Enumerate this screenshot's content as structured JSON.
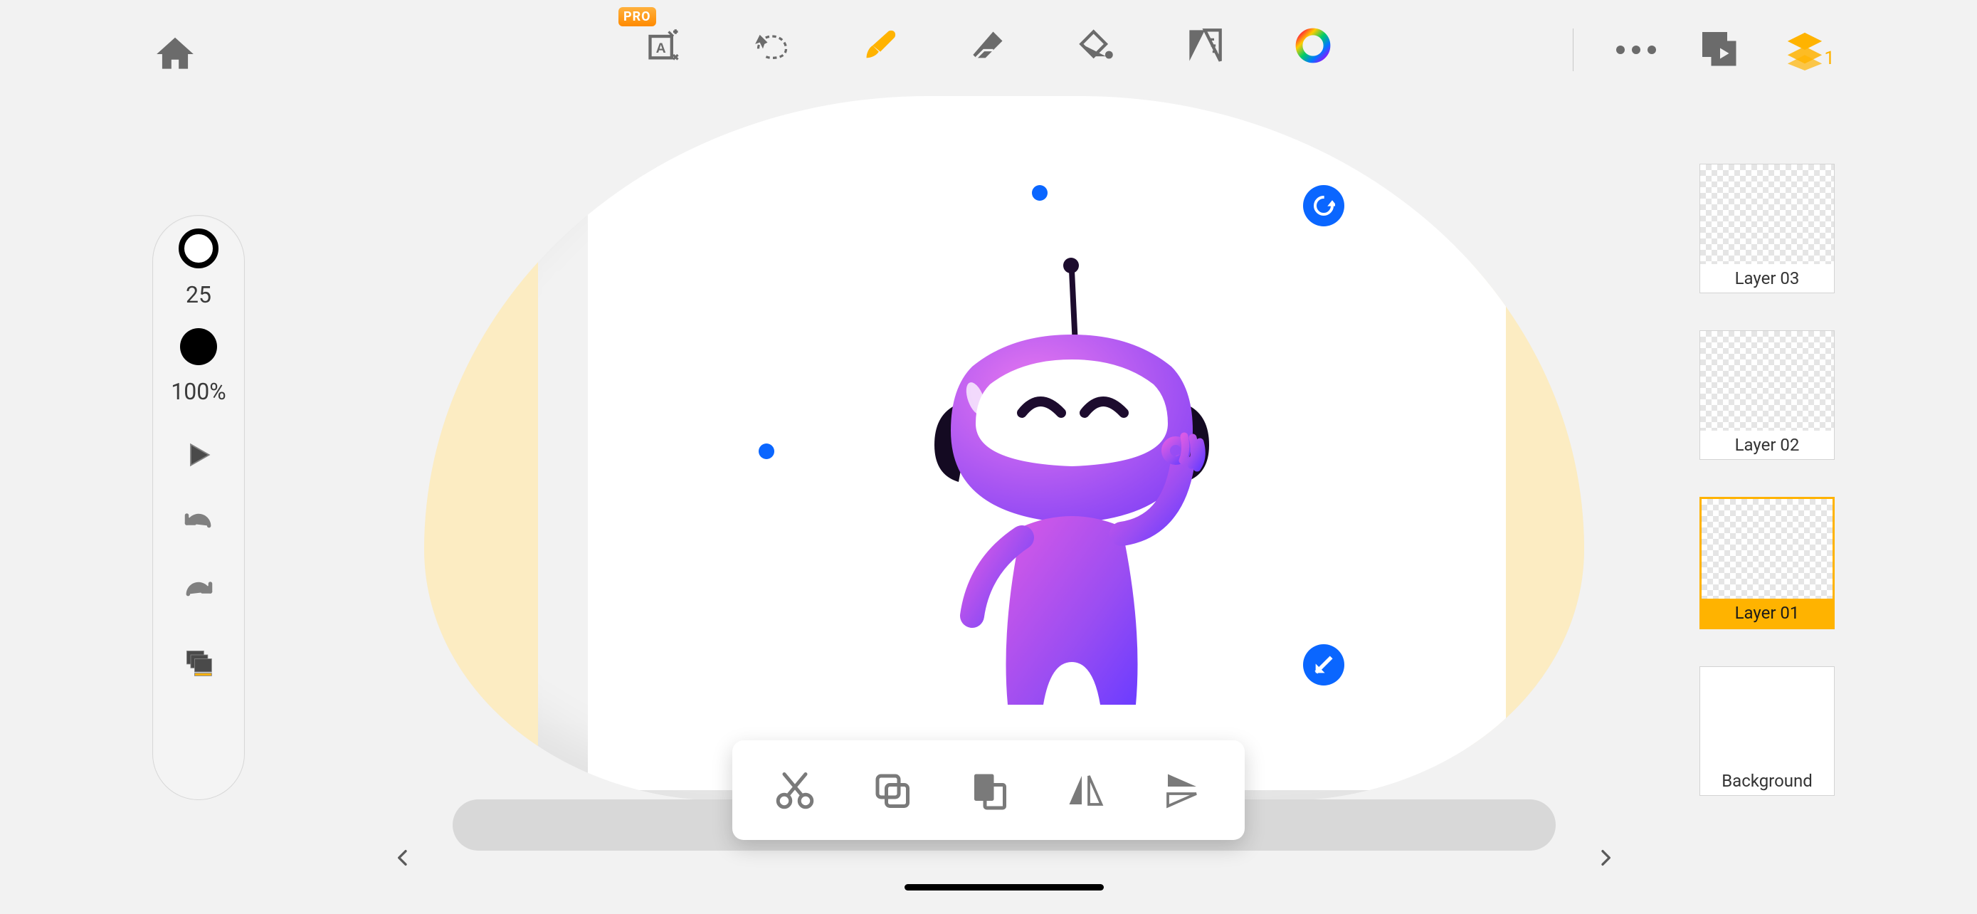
{
  "colors": {
    "accent_orange": "#ffb300",
    "selection_blue": "#0a66ff",
    "icon_gray": "#6b6b6b",
    "bg": "#f2f2f2"
  },
  "toolbar": {
    "home": "home",
    "tools": {
      "text": {
        "name": "text-tool",
        "pro_badge": "PRO"
      },
      "lasso": {
        "name": "lasso-tool"
      },
      "brush": {
        "name": "brush-tool",
        "active": true
      },
      "eraser": {
        "name": "eraser-tool"
      },
      "fill": {
        "name": "fill-tool"
      },
      "ruler": {
        "name": "ruler-tool"
      },
      "color": {
        "name": "color-wheel"
      }
    },
    "right": {
      "more": "more-options",
      "play": "play-frames-button",
      "layers": {
        "name": "layers-button",
        "count": "1"
      }
    }
  },
  "left_pod": {
    "brush_size_label": "25",
    "opacity_label": "100%",
    "play": "play-button",
    "undo": "undo-button",
    "redo": "redo-button",
    "frames": "frames-button"
  },
  "context_bar": {
    "cut": "cut-button",
    "copy": "copy-button",
    "paste": "paste-button",
    "flip_h": "flip-horizontal-button",
    "flip_v": "flip-vertical-button"
  },
  "layers": {
    "active_index": 2,
    "items": [
      {
        "label": "Layer 03",
        "transparent": true
      },
      {
        "label": "Layer 02",
        "transparent": true
      },
      {
        "label": "Layer 01",
        "transparent": true
      },
      {
        "label": "Background",
        "transparent": false
      }
    ]
  },
  "selection_controls": {
    "rotate": "rotate-handle",
    "scale": "scale-handle",
    "handles": [
      "top",
      "left",
      "bottom"
    ]
  },
  "timeline": {
    "prev": "previous-frame",
    "next": "next-frame"
  }
}
